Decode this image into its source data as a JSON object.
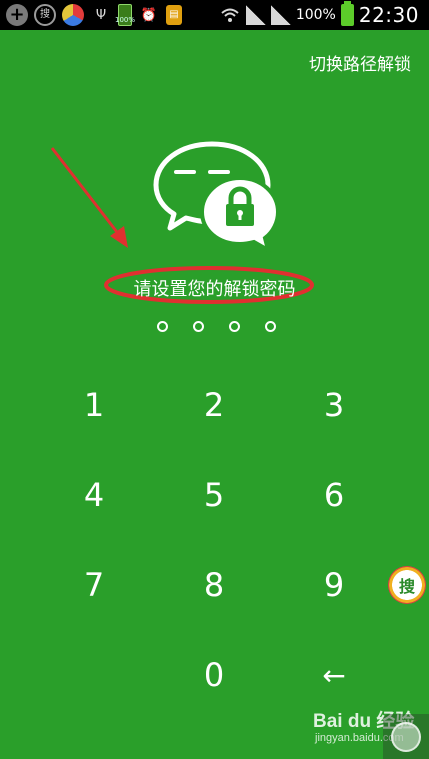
{
  "status_bar": {
    "left_icons": [
      "add-icon",
      "sou-search-icon",
      "color-ball-icon",
      "usb-icon",
      "battery-app-icon",
      "alarm-icon",
      "sim-icon"
    ],
    "search_glyph": "搜",
    "battery_app_label": "100%",
    "battery_percent": "100%",
    "time": "22:30"
  },
  "header": {
    "switch_label": "切换路径解锁"
  },
  "prompt": {
    "text": "请设置您的解锁密码"
  },
  "passcode": {
    "length": 4,
    "filled": 0
  },
  "keypad": {
    "keys": [
      "1",
      "2",
      "3",
      "4",
      "5",
      "6",
      "7",
      "8",
      "9",
      "0"
    ],
    "backspace_glyph": "←"
  },
  "overlay": {
    "sou_badge": "搜"
  },
  "watermark": {
    "brand": "Bai du 经验",
    "sub": "jingyan.baidu.com"
  },
  "colors": {
    "background": "#2a9f2a",
    "annotation": "#e03030",
    "text": "#ffffff"
  }
}
